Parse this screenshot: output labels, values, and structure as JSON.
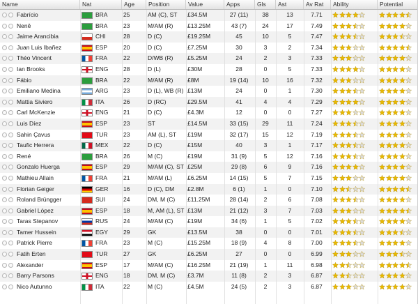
{
  "columns": {
    "name": "Name",
    "nat": "Nat",
    "age": "Age",
    "position": "Position",
    "value": "Value",
    "apps": "Apps",
    "gls": "Gls",
    "ast": "Ast",
    "avrat": "Av Rat",
    "ability": "Ability",
    "potential": "Potential"
  },
  "flags": {
    "BRA": "brazil-flag",
    "CHI": "chile-flag",
    "ESP": "spain-flag",
    "FRA": "france-flag",
    "ENG": "england-flag",
    "ARG": "argentina-flag",
    "ITA": "italy-flag",
    "TUR": "turkey-flag",
    "MEX": "mexico-flag",
    "GER": "germany-flag",
    "SUI": "switzerland-flag",
    "RUS": "russia-flag",
    "EGY": "egypt-flag"
  },
  "colors": {
    "star_full": "#e8b800",
    "star_empty": "#dcdcdc",
    "row_alt": "#f2f2f2"
  },
  "players": [
    {
      "name": "Fabrício",
      "nat": "BRA",
      "age": "25",
      "position": "AM (C), ST",
      "value": "£34.5M",
      "apps": "27 (11)",
      "gls": "38",
      "ast": "13",
      "avrat": "7.71",
      "ability": 4,
      "potential": 4.5
    },
    {
      "name": "Nenê",
      "nat": "BRA",
      "age": "23",
      "position": "M/AM (R)",
      "value": "£13.25M",
      "apps": "43 (7)",
      "gls": "24",
      "ast": "17",
      "avrat": "7.49",
      "ability": 3.5,
      "potential": 4
    },
    {
      "name": "Jaime Arancibia",
      "nat": "CHI",
      "age": "28",
      "position": "D (C)",
      "value": "£19.25M",
      "apps": "45",
      "gls": "10",
      "ast": "5",
      "avrat": "7.47",
      "ability": 3.5,
      "potential": 3.5
    },
    {
      "name": "Juan Luis Ibañez",
      "nat": "ESP",
      "age": "20",
      "position": "D (C)",
      "value": "£7.25M",
      "apps": "30",
      "gls": "3",
      "ast": "2",
      "avrat": "7.34",
      "ability": 3,
      "potential": 4.5
    },
    {
      "name": "Théo Vincent",
      "nat": "FRA",
      "age": "22",
      "position": "D/WB (R)",
      "value": "£5.25M",
      "apps": "24",
      "gls": "2",
      "ast": "3",
      "avrat": "7.33",
      "ability": 3,
      "potential": 4
    },
    {
      "name": "Ian Brooks",
      "nat": "ENG",
      "age": "28",
      "position": "D (L)",
      "value": "£30M",
      "apps": "28",
      "gls": "0",
      "ast": "5",
      "avrat": "7.33",
      "ability": 4,
      "potential": 4
    },
    {
      "name": "Fábio",
      "nat": "BRA",
      "age": "22",
      "position": "M/AM (R)",
      "value": "£8M",
      "apps": "19 (14)",
      "gls": "10",
      "ast": "16",
      "avrat": "7.32",
      "ability": 3,
      "potential": 4
    },
    {
      "name": "Emiliano Medina",
      "nat": "ARG",
      "age": "23",
      "position": "D (L), WB (R)",
      "value": "£13M",
      "apps": "24",
      "gls": "0",
      "ast": "1",
      "avrat": "7.30",
      "ability": 3.5,
      "potential": 4
    },
    {
      "name": "Mattia Siviero",
      "nat": "ITA",
      "age": "26",
      "position": "D (RC)",
      "value": "£29.5M",
      "apps": "41",
      "gls": "4",
      "ast": "4",
      "avrat": "7.29",
      "ability": 4,
      "potential": 4
    },
    {
      "name": "Carl McKenzie",
      "nat": "ENG",
      "age": "21",
      "position": "D (C)",
      "value": "£4.3M",
      "apps": "12",
      "gls": "0",
      "ast": "0",
      "avrat": "7.27",
      "ability": 3,
      "potential": 4
    },
    {
      "name": "Luis Díez",
      "nat": "ESP",
      "age": "23",
      "position": "ST",
      "value": "£14.5M",
      "apps": "33 (15)",
      "gls": "29",
      "ast": "11",
      "avrat": "7.24",
      "ability": 3.5,
      "potential": 4
    },
    {
      "name": "Sahin Çavus",
      "nat": "TUR",
      "age": "23",
      "position": "AM (L), ST",
      "value": "£19M",
      "apps": "32 (17)",
      "gls": "15",
      "ast": "12",
      "avrat": "7.19",
      "ability": 3.5,
      "potential": 4
    },
    {
      "name": "Taufic Herrera",
      "nat": "MEX",
      "age": "22",
      "position": "D (C)",
      "value": "£15M",
      "apps": "40",
      "gls": "3",
      "ast": "1",
      "avrat": "7.17",
      "ability": 3.5,
      "potential": 4
    },
    {
      "name": "René",
      "nat": "BRA",
      "age": "26",
      "position": "M (C)",
      "value": "£19M",
      "apps": "31 (9)",
      "gls": "5",
      "ast": "12",
      "avrat": "7.16",
      "ability": 3.5,
      "potential": 4
    },
    {
      "name": "Gonzalo Huerga",
      "nat": "ESP",
      "age": "29",
      "position": "M/AM (C), ST",
      "value": "£25M",
      "apps": "29 (8)",
      "gls": "6",
      "ast": "9",
      "avrat": "7.16",
      "ability": 4,
      "potential": 4
    },
    {
      "name": "Mathieu Allain",
      "nat": "FRA",
      "age": "21",
      "position": "M/AM (L)",
      "value": "£6.25M",
      "apps": "14 (15)",
      "gls": "5",
      "ast": "7",
      "avrat": "7.15",
      "ability": 3,
      "potential": 4
    },
    {
      "name": "Florian Geiger",
      "nat": "GER",
      "age": "16",
      "position": "D (C), DM",
      "value": "£2.8M",
      "apps": "6 (1)",
      "gls": "1",
      "ast": "0",
      "avrat": "7.10",
      "ability": 2.5,
      "potential": 4.5
    },
    {
      "name": "Roland Brüngger",
      "nat": "SUI",
      "age": "24",
      "position": "DM, M (C)",
      "value": "£11.25M",
      "apps": "28 (14)",
      "gls": "2",
      "ast": "6",
      "avrat": "7.08",
      "ability": 3.5,
      "potential": 4
    },
    {
      "name": "Gabriel López",
      "nat": "ESP",
      "age": "18",
      "position": "M, AM (L), ST",
      "value": "£13M",
      "apps": "21 (12)",
      "gls": "3",
      "ast": "7",
      "avrat": "7.03",
      "ability": 3,
      "potential": 4.5
    },
    {
      "name": "Taras Stepanov",
      "nat": "RUS",
      "age": "24",
      "position": "M/AM (C)",
      "value": "£19M",
      "apps": "34 (6)",
      "gls": "1",
      "ast": "5",
      "avrat": "7.02",
      "ability": 3.5,
      "potential": 4
    },
    {
      "name": "Tamer Hussein",
      "nat": "EGY",
      "age": "29",
      "position": "GK",
      "value": "£13.5M",
      "apps": "38",
      "gls": "0",
      "ast": "0",
      "avrat": "7.01",
      "ability": 3.5,
      "potential": 3.5
    },
    {
      "name": "Patrick Pierre",
      "nat": "FRA",
      "age": "23",
      "position": "M (C)",
      "value": "£15.25M",
      "apps": "18 (9)",
      "gls": "4",
      "ast": "8",
      "avrat": "7.00",
      "ability": 3.5,
      "potential": 4
    },
    {
      "name": "Fatih Erten",
      "nat": "TUR",
      "age": "27",
      "position": "GK",
      "value": "£6.25M",
      "apps": "27",
      "gls": "0",
      "ast": "0",
      "avrat": "6.99",
      "ability": 3,
      "potential": 3.5
    },
    {
      "name": "Alexander",
      "nat": "ESP",
      "age": "17",
      "position": "M/AM (C)",
      "value": "£16.25M",
      "apps": "21 (19)",
      "gls": "1",
      "ast": "11",
      "avrat": "6.98",
      "ability": 2.5,
      "potential": 4.5
    },
    {
      "name": "Barry Parsons",
      "nat": "ENG",
      "age": "18",
      "position": "DM, M (C)",
      "value": "£3.7M",
      "apps": "11 (8)",
      "gls": "2",
      "ast": "3",
      "avrat": "6.87",
      "ability": 2.5,
      "potential": 4
    },
    {
      "name": "Nico Autunno",
      "nat": "ITA",
      "age": "22",
      "position": "M (C)",
      "value": "£4.5M",
      "apps": "24 (5)",
      "gls": "2",
      "ast": "3",
      "avrat": "6.87",
      "ability": 3,
      "potential": 4
    }
  ]
}
